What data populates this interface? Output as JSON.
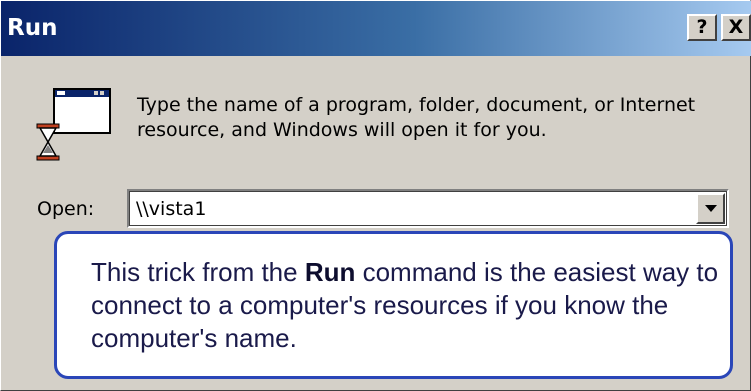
{
  "window": {
    "title": "Run",
    "help_glyph": "?",
    "close_glyph": "X"
  },
  "description": "Type the name of a program, folder, document, or Internet resource, and Windows will open it for you.",
  "open_field": {
    "label": "Open:",
    "value": "\\\\vista1"
  },
  "icons": {
    "program": "run-program-icon",
    "dropdown": "chevron-down-icon"
  },
  "callout": {
    "before": "This trick from the ",
    "bold": "Run",
    "after": " command is the easiest way to connect to a computer's resources if you know the computer's name."
  },
  "colors": {
    "titlebar_start": "#0a246a",
    "titlebar_end": "#a6caf0",
    "dialog_bg": "#d4d0c8",
    "callout_border": "#2a46b8"
  }
}
